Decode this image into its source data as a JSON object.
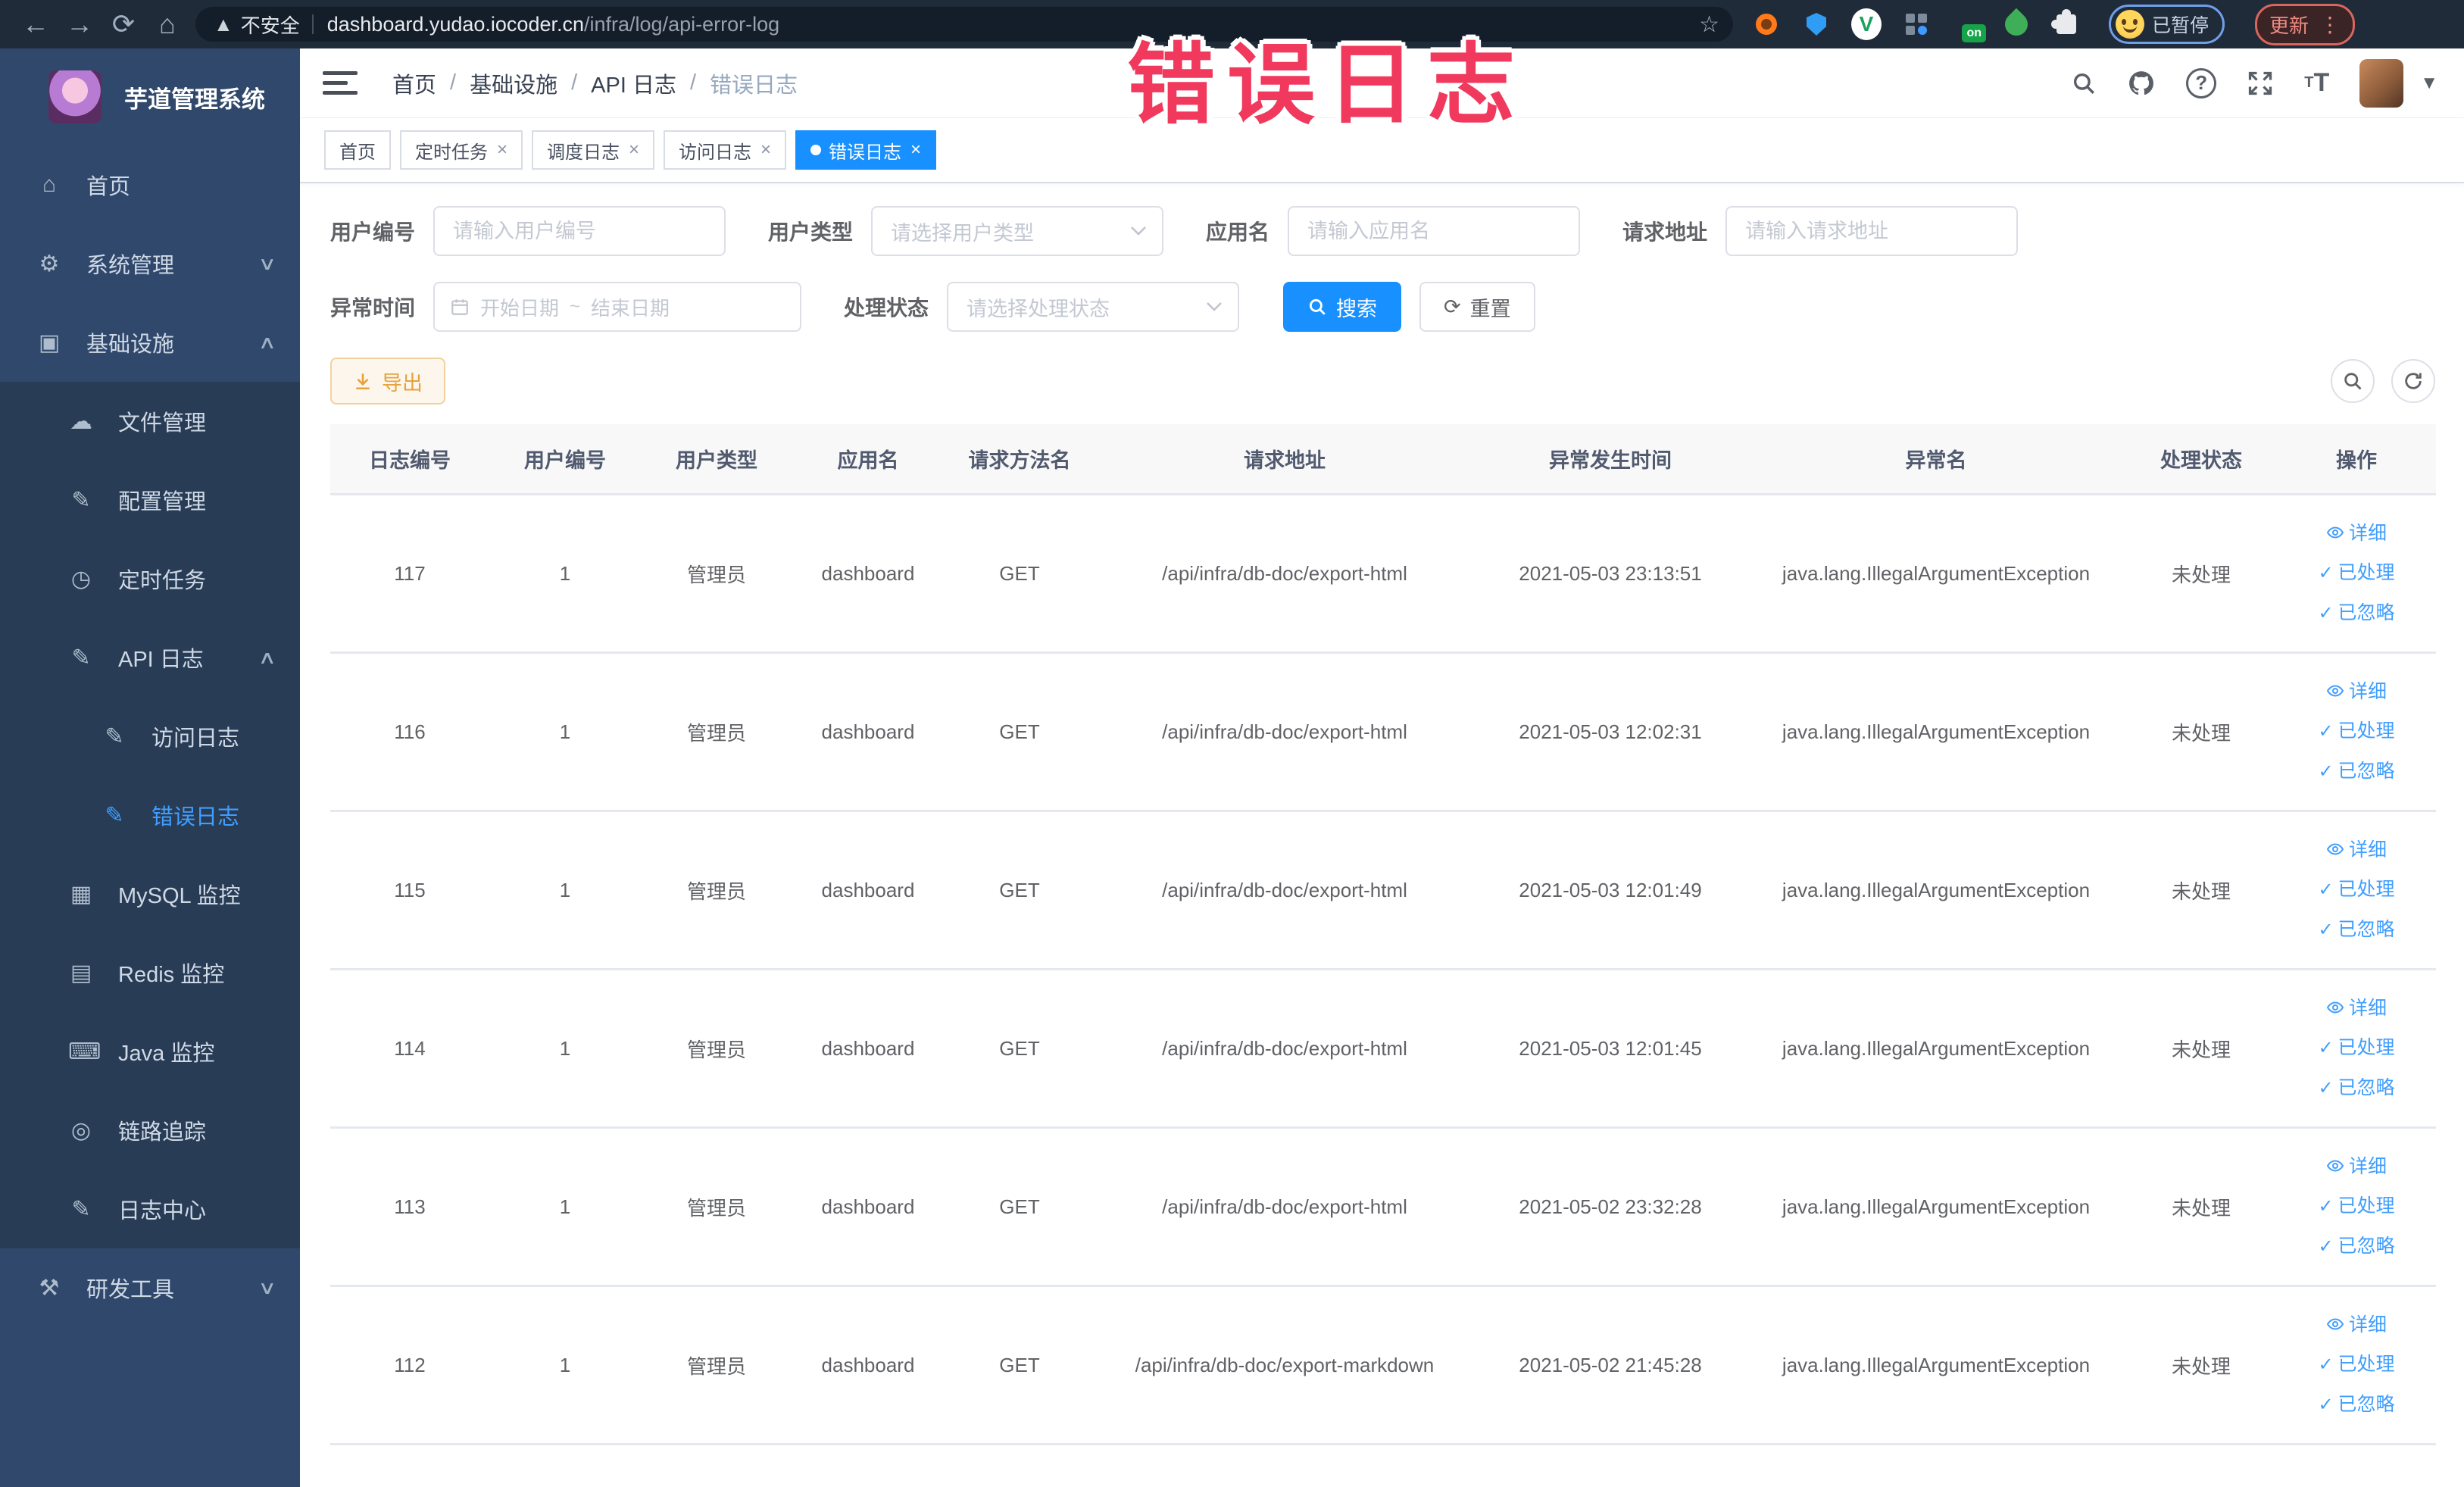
{
  "browser": {
    "security_label": "不安全",
    "url_domain": "dashboard.yudao.iocoder.cn",
    "url_path": "/infra/log/api-error-log",
    "extension_on_badge": "on",
    "profile_badge_label": "已暂停",
    "update_button_label": "更新"
  },
  "overlay_title": "错误日志",
  "colors": {
    "primary": "#1890ff",
    "link": "#409eff",
    "warning": "#e6a23c",
    "overlay_pink": "#f0395c",
    "sidebar_bg": "#30486b",
    "submenu_bg": "#283c55"
  },
  "sidebar": {
    "app_title": "芋道管理系统",
    "menu": [
      {
        "label": "首页",
        "icon": "home-icon",
        "glyph": "⌂",
        "level": 0
      },
      {
        "label": "系统管理",
        "icon": "gear-icon",
        "glyph": "⚙",
        "level": 0,
        "chevron": "down"
      },
      {
        "label": "基础设施",
        "icon": "infrastructure-icon",
        "glyph": "▣",
        "level": 0,
        "chevron": "up"
      },
      {
        "label": "文件管理",
        "icon": "file-manage-icon",
        "glyph": "☁",
        "level": 1
      },
      {
        "label": "配置管理",
        "icon": "config-manage-icon",
        "glyph": "✎",
        "level": 1
      },
      {
        "label": "定时任务",
        "icon": "scheduled-task-icon",
        "glyph": "◷",
        "level": 1
      },
      {
        "label": "API 日志",
        "icon": "api-log-icon",
        "glyph": "✎",
        "level": 1,
        "chevron": "up"
      },
      {
        "label": "访问日志",
        "icon": "access-log-icon",
        "glyph": "✎",
        "level": 2
      },
      {
        "label": "错误日志",
        "icon": "error-log-icon",
        "glyph": "✎",
        "level": 2,
        "active": true
      },
      {
        "label": "MySQL 监控",
        "icon": "mysql-monitor-icon",
        "glyph": "▦",
        "level": 1
      },
      {
        "label": "Redis 监控",
        "icon": "redis-monitor-icon",
        "glyph": "▤",
        "level": 1
      },
      {
        "label": "Java 监控",
        "icon": "java-monitor-icon",
        "glyph": "⌨",
        "level": 1
      },
      {
        "label": "链路追踪",
        "icon": "trace-icon",
        "glyph": "◎",
        "level": 1
      },
      {
        "label": "日志中心",
        "icon": "log-center-icon",
        "glyph": "✎",
        "level": 1
      },
      {
        "label": "研发工具",
        "icon": "dev-tools-icon",
        "glyph": "⚒",
        "level": 0,
        "chevron": "down"
      }
    ]
  },
  "breadcrumb": [
    "首页",
    "基础设施",
    "API 日志",
    "错误日志"
  ],
  "tags_view": [
    {
      "label": "首页",
      "closable": false,
      "active": false
    },
    {
      "label": "定时任务",
      "closable": true,
      "active": false
    },
    {
      "label": "调度日志",
      "closable": true,
      "active": false
    },
    {
      "label": "访问日志",
      "closable": true,
      "active": false
    },
    {
      "label": "错误日志",
      "closable": true,
      "active": true
    }
  ],
  "filters": {
    "user_id": {
      "label": "用户编号",
      "placeholder": "请输入用户编号"
    },
    "user_type": {
      "label": "用户类型",
      "placeholder": "请选择用户类型"
    },
    "app_name": {
      "label": "应用名",
      "placeholder": "请输入应用名"
    },
    "request_url": {
      "label": "请求地址",
      "placeholder": "请输入请求地址"
    },
    "exception_time": {
      "label": "异常时间",
      "start_placeholder": "开始日期",
      "separator": "~",
      "end_placeholder": "结束日期"
    },
    "process_status": {
      "label": "处理状态",
      "placeholder": "请选择处理状态"
    },
    "search_label": "搜索",
    "reset_label": "重置"
  },
  "toolbar": {
    "export_label": "导出"
  },
  "table": {
    "columns": [
      "日志编号",
      "用户编号",
      "用户类型",
      "应用名",
      "请求方法名",
      "请求地址",
      "异常发生时间",
      "异常名",
      "处理状态",
      "操作"
    ],
    "actions": [
      "详细",
      "已处理",
      "已忽略"
    ],
    "rows": [
      {
        "id": "117",
        "user_id": "1",
        "user_type": "管理员",
        "app": "dashboard",
        "method": "GET",
        "url": "/api/infra/db-doc/export-html",
        "time": "2021-05-03 23:13:51",
        "exception": "java.lang.IllegalArgumentException",
        "status": "未处理"
      },
      {
        "id": "116",
        "user_id": "1",
        "user_type": "管理员",
        "app": "dashboard",
        "method": "GET",
        "url": "/api/infra/db-doc/export-html",
        "time": "2021-05-03 12:02:31",
        "exception": "java.lang.IllegalArgumentException",
        "status": "未处理"
      },
      {
        "id": "115",
        "user_id": "1",
        "user_type": "管理员",
        "app": "dashboard",
        "method": "GET",
        "url": "/api/infra/db-doc/export-html",
        "time": "2021-05-03 12:01:49",
        "exception": "java.lang.IllegalArgumentException",
        "status": "未处理"
      },
      {
        "id": "114",
        "user_id": "1",
        "user_type": "管理员",
        "app": "dashboard",
        "method": "GET",
        "url": "/api/infra/db-doc/export-html",
        "time": "2021-05-03 12:01:45",
        "exception": "java.lang.IllegalArgumentException",
        "status": "未处理"
      },
      {
        "id": "113",
        "user_id": "1",
        "user_type": "管理员",
        "app": "dashboard",
        "method": "GET",
        "url": "/api/infra/db-doc/export-html",
        "time": "2021-05-02 23:32:28",
        "exception": "java.lang.IllegalArgumentException",
        "status": "未处理"
      },
      {
        "id": "112",
        "user_id": "1",
        "user_type": "管理员",
        "app": "dashboard",
        "method": "GET",
        "url": "/api/infra/db-doc/export-markdown",
        "time": "2021-05-02 21:45:28",
        "exception": "java.lang.IllegalArgumentException",
        "status": "未处理"
      }
    ]
  }
}
